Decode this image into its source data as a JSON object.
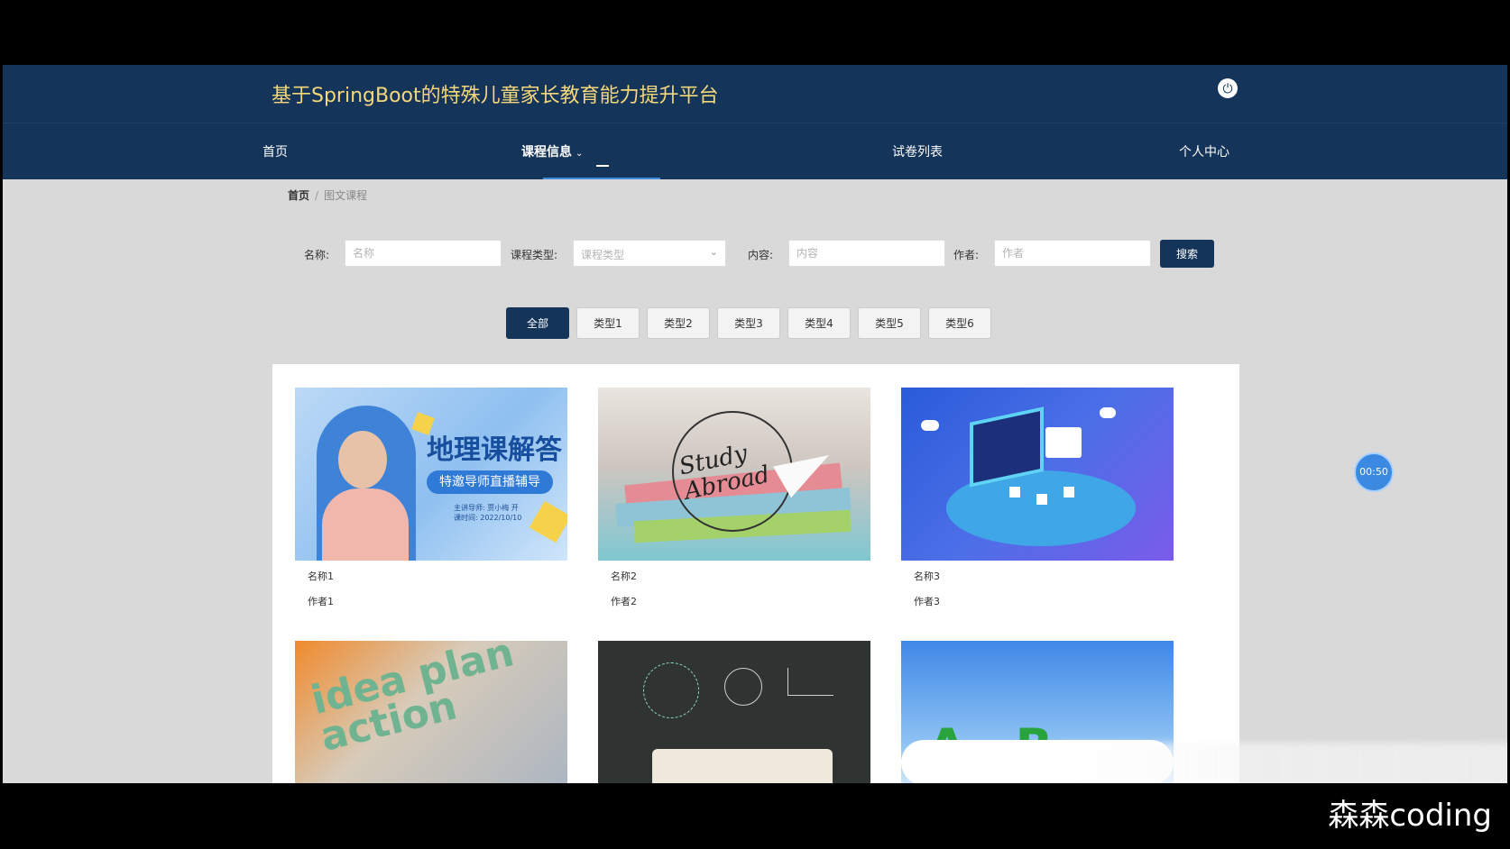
{
  "header": {
    "title": "基于SpringBoot的特殊儿童家长教育能力提升平台",
    "power_icon": "power-icon"
  },
  "nav": {
    "items": [
      {
        "label": "首页"
      },
      {
        "label": "课程信息",
        "active": true
      },
      {
        "label": "试卷列表"
      },
      {
        "label": "个人中心"
      }
    ],
    "dropdown_icon": "chevron-down-icon"
  },
  "breadcrumb": {
    "home": "首页",
    "separator": "/",
    "current": "图文课程"
  },
  "search": {
    "name_label": "名称:",
    "name_placeholder": "名称",
    "type_label": "课程类型:",
    "type_placeholder": "课程类型",
    "content_label": "内容:",
    "content_placeholder": "内容",
    "author_label": "作者:",
    "author_placeholder": "作者",
    "button": "搜索"
  },
  "filters": {
    "items": [
      "全部",
      "类型1",
      "类型2",
      "类型3",
      "类型4",
      "类型5",
      "类型6"
    ],
    "active_index": 0
  },
  "courses": [
    {
      "name": "名称1",
      "author": "作者1",
      "thumb_text": "地理课解答",
      "thumb_sub": "特邀导师直播辅导",
      "thumb_small": "主讲导师: 贾小梅 开\n课时间: 2022/10/10"
    },
    {
      "name": "名称2",
      "author": "作者2",
      "thumb_text": "Study Abroad"
    },
    {
      "name": "名称3",
      "author": "作者3"
    },
    {
      "name": "",
      "author": "",
      "thumb_text": "idea plan action"
    },
    {
      "name": "",
      "author": ""
    },
    {
      "name": "",
      "author": "",
      "thumb_text": "A B"
    }
  ],
  "timer": "00:50",
  "watermark": "森森coding",
  "colors": {
    "primary": "#15345a",
    "title": "#f4d77a",
    "background": "#d9d9d9"
  }
}
